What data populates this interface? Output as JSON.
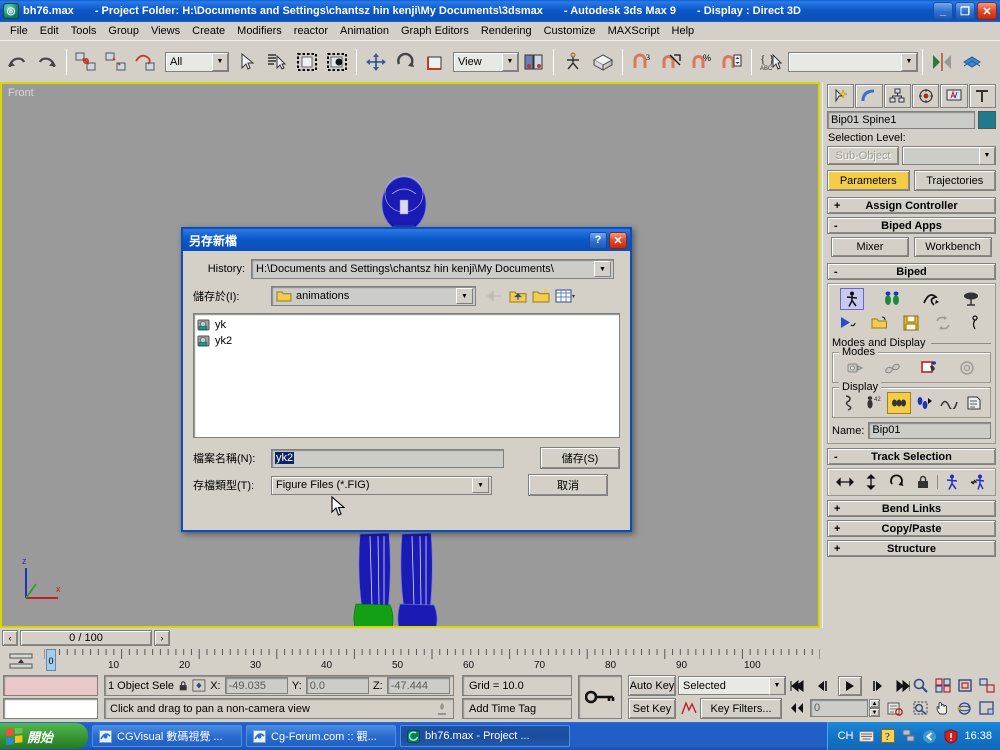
{
  "titlebar": {
    "icon": "3dsmax-logo-icon",
    "file": "bh76.max",
    "project": "- Project Folder: H:\\Documents and Settings\\chantsz hin kenji\\My Documents\\3dsmax",
    "app": "- Autodesk 3ds Max 9",
    "display": "- Display : Direct 3D",
    "minimize": "_",
    "maximize": "❐",
    "close": "✕"
  },
  "menubar": {
    "items": [
      "File",
      "Edit",
      "Tools",
      "Group",
      "Views",
      "Create",
      "Modifiers",
      "reactor",
      "Animation",
      "Graph Editors",
      "Rendering",
      "Customize",
      "MAXScript",
      "Help"
    ]
  },
  "toolbar": {
    "selection_filter": "All",
    "reference_coord": "View",
    "named_selection": "",
    "buttons": [
      "undo-icon",
      "redo-icon",
      "select-link-icon",
      "unlink-icon",
      "bind-space-warp-icon",
      "select-object-icon",
      "select-by-name-icon",
      "select-region-icon",
      "window-crossing-icon",
      "select-move-icon",
      "select-rotate-icon",
      "select-scale-icon",
      "use-pivot-center-icon",
      "mirror-icon",
      "align-icon",
      "snap-3d-icon",
      "angle-snap-icon",
      "percent-snap-icon",
      "spinner-snap-icon",
      "named-selection-icon",
      "mirror-flip-icon",
      "layer-manager-icon"
    ]
  },
  "viewport": {
    "label": "Front",
    "axis": {
      "z": "z",
      "y": "y",
      "x": "x"
    }
  },
  "command_panel": {
    "tabs": [
      "create-tab-icon",
      "modify-tab-icon",
      "hierarchy-tab-icon",
      "motion-tab-icon",
      "display-tab-icon",
      "utilities-tab-icon"
    ],
    "object_name": "Bip01 Spine1",
    "object_color": "#1d7b8c",
    "selection_level_label": "Selection Level:",
    "sub_object_button": "Sub-Object",
    "sub_object_value": "",
    "parameters_button": "Parameters",
    "trajectories_button": "Trajectories",
    "rollups": [
      {
        "sign": "+",
        "title": "Assign Controller"
      },
      {
        "sign": "-",
        "title": "Biped Apps"
      },
      {
        "sign": "-",
        "title": "Biped"
      },
      {
        "sign": "-",
        "title": "Track Selection"
      },
      {
        "sign": "+",
        "title": "Bend Links"
      },
      {
        "sign": "+",
        "title": "Copy/Paste"
      },
      {
        "sign": "+",
        "title": "Structure"
      }
    ],
    "biped_apps": {
      "mixer": "Mixer",
      "workbench": "Workbench"
    },
    "biped": {
      "row1_icons": [
        "figure-mode-icon",
        "footstep-mode-icon",
        "motion-flow-mode-icon",
        "mixer-mode-icon"
      ],
      "row2_icons": [
        "load-motion-icon",
        "load-file-icon",
        "save-file-icon",
        "convert-icon",
        "move-all-mode-icon"
      ],
      "modes_and_display_label": "Modes and Display",
      "modes_label": "Modes",
      "modes_icons": [
        "buffer-mode-icon",
        "rubber-band-mode-icon",
        "scale-stride-mode-icon",
        "in-place-mode-icon"
      ],
      "display_label": "Display",
      "display_icons": [
        "bones-display-icon",
        "objects-display-icon",
        "footsteps-display-icon",
        "footstep-numbers-icon",
        "trajectories-icon",
        "twist-links-icon"
      ],
      "name_label": "Name:",
      "name_value": "Bip01"
    },
    "track_selection_icons": [
      "body-horizontal-icon",
      "body-vertical-icon",
      "body-rotation-icon",
      "lock-cos-icon",
      "symmetrical-tracks-icon",
      "opposite-tracks-icon"
    ]
  },
  "time_slider": {
    "prev_label": "‹",
    "next_label": "›",
    "current": "0 / 100"
  },
  "trackbar": {
    "ticks": [
      "10",
      "20",
      "30",
      "40",
      "50",
      "60",
      "70",
      "80",
      "90",
      "100"
    ],
    "frame_marker": "0"
  },
  "status_bar": {
    "selection_count": "1 Object Sele",
    "lock_icon": "lock-selection-icon",
    "absolute_mode_icon": "absolute-relative-mode-icon",
    "x_label": "X:",
    "x_value": "-49.035",
    "y_label": "Y:",
    "y_value": "0.0",
    "z_label": "Z:",
    "z_value": "-47.444",
    "grid": "Grid = 10.0",
    "add_time_tag": "Add Time Tag",
    "prompt": "Click and drag to pan a non-camera view",
    "key_mode_icon": "key-mode-toggle-icon",
    "auto_key": "Auto Key",
    "set_key": "Set Key",
    "key_filters": "Key Filters...",
    "selection_set": "Selected",
    "current_frame": "0",
    "playback_icons": [
      "go-to-start-icon",
      "previous-frame-icon",
      "play-animation-icon",
      "next-frame-icon",
      "go-to-end-icon",
      "key-mode-icon"
    ],
    "nav_icons": [
      "zoom-icon",
      "zoom-all-icon",
      "zoom-extents-icon",
      "zoom-extents-all-icon",
      "field-of-view-icon",
      "zoom-region-icon",
      "pan-view-icon",
      "arc-rotate-icon",
      "maximize-viewport-icon"
    ]
  },
  "save_dialog": {
    "title": "另存新檔",
    "help_button": "?",
    "close_button": "✕",
    "history_label": "History:",
    "history_value": "H:\\Documents and Settings\\chantsz hin kenji\\My Documents\\",
    "save_in_label": "儲存於(I):",
    "save_in_value": "animations",
    "nav_icons": [
      "back-icon",
      "up-one-level-icon",
      "create-new-folder-icon",
      "views-icon"
    ],
    "files": [
      {
        "icon": "fig-file-icon",
        "name": "yk"
      },
      {
        "icon": "fig-file-icon",
        "name": "yk2"
      }
    ],
    "filename_label": "檔案名稱(N):",
    "filename_value": "yk2",
    "filetype_label": "存檔類型(T):",
    "filetype_value": "Figure Files (*.FIG)",
    "save_button": "儲存(S)",
    "cancel_button": "取消"
  },
  "taskbar": {
    "start": "開始",
    "items": [
      {
        "icon": "ie-icon",
        "label": "CGVisual 數碼視覺 ..."
      },
      {
        "icon": "ie-icon",
        "label": "Cg-Forum.com :: 觀..."
      },
      {
        "icon": "3dsmax-logo-icon",
        "label": "bh76.max    - Project ..."
      }
    ],
    "tray": {
      "language": "CH",
      "icons": [
        "keyboard-icon",
        "help-icon",
        "network-icon",
        "back-arrow-icon",
        "security-shield-icon"
      ],
      "clock": "16:38"
    }
  }
}
